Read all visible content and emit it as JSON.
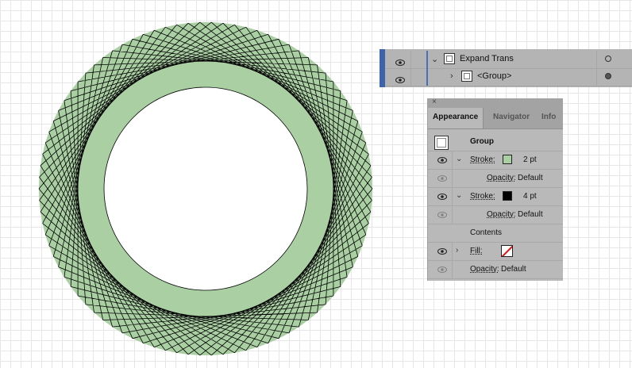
{
  "layers": {
    "rows": [
      {
        "name": "Expand Trans",
        "expanded": true
      },
      {
        "name": "<Group>",
        "expanded": false
      }
    ]
  },
  "appearance": {
    "close_glyph": "×",
    "tabs": [
      "Appearance",
      "Navigator",
      "Info"
    ],
    "group_label": "Group",
    "stroke1": {
      "label": "Stroke:",
      "weight": "2 pt",
      "color": "#a9cfa3"
    },
    "opacity1": {
      "label": "Opacity:",
      "value": "Default"
    },
    "stroke2": {
      "label": "Stroke:",
      "weight": "4 pt",
      "color": "#000000"
    },
    "opacity2": {
      "label": "Opacity:",
      "value": "Default"
    },
    "contents_label": "Contents",
    "fill": {
      "label": "Fill:"
    },
    "opacity3": {
      "label": "Opacity:",
      "value": "Default"
    }
  },
  "artwork": {
    "fill_color": "#a9cfa3",
    "stroke_color": "#000000"
  }
}
